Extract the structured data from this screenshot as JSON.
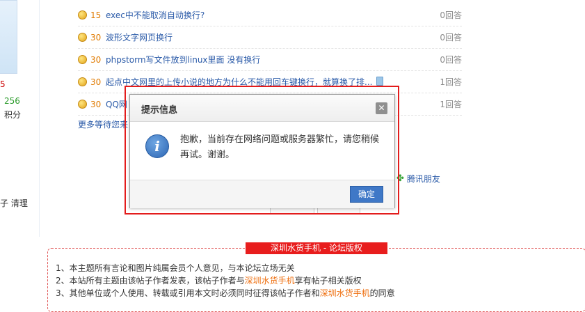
{
  "left": {
    "five": "5",
    "score_number": "256",
    "score_label": "积分",
    "clean_text": "子 清理"
  },
  "questions": [
    {
      "points": "15",
      "title": "exec中不能取消自动换行?",
      "answers": "0回答"
    },
    {
      "points": "30",
      "title": "波形文字网页换行",
      "answers": "0回答"
    },
    {
      "points": "30",
      "title": "phpstorm写文件放到linux里面 没有换行",
      "answers": "0回答"
    },
    {
      "points": "30",
      "title": "起点中文网里的上传小说的地方为什么不能用回车键换行，就算换了排...",
      "answers": "1回答"
    },
    {
      "points": "30",
      "title": "QQ网",
      "answers": "1回答"
    }
  ],
  "more_link": "更多等待您来",
  "tencent_friends": "腾讯朋友",
  "dialog": {
    "title": "提示信息",
    "close": "✕",
    "message": "抱歉，当前存在网络问题或服务器繁忙，请您稍候再试。谢谢。",
    "ok": "确定"
  },
  "copyright": {
    "title": "深圳水货手机 - 论坛版权",
    "line1": "1、本主题所有言论和图片纯属会员个人意见，与本论坛立场无关",
    "line2_a": "2、本站所有主题由该帖子作者发表，该帖子作者与",
    "line2_brand": "深圳水货手机",
    "line2_b": "享有帖子相关版权",
    "line3_a": "3、其他单位或个人使用、转载或引用本文时必须同时征得该帖子作者和",
    "line3_brand": "深圳水货手机",
    "line3_b": "的同意"
  }
}
